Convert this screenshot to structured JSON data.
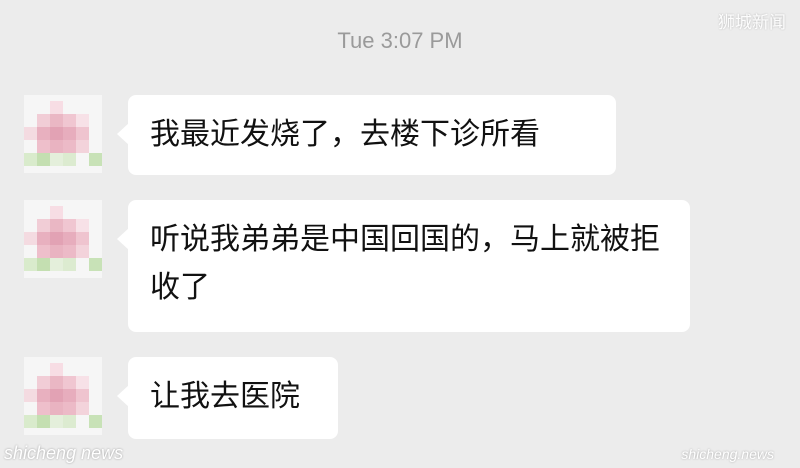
{
  "chat": {
    "timestamp": "Tue 3:07 PM",
    "messages": [
      {
        "text": "我最近发烧了，去楼下诊所看"
      },
      {
        "text": "听说我弟弟是中国回国的，马上就被拒收了"
      },
      {
        "text": "让我去医院"
      }
    ]
  },
  "watermarks": {
    "top_right": "狮城新闻",
    "bottom_left": "shicheng news",
    "bottom_right": "shicheng.news"
  },
  "colors": {
    "background": "#ececec",
    "bubble": "#ffffff",
    "avatar_pink": "#f2c9d3",
    "avatar_green": "#c6e0b4"
  }
}
